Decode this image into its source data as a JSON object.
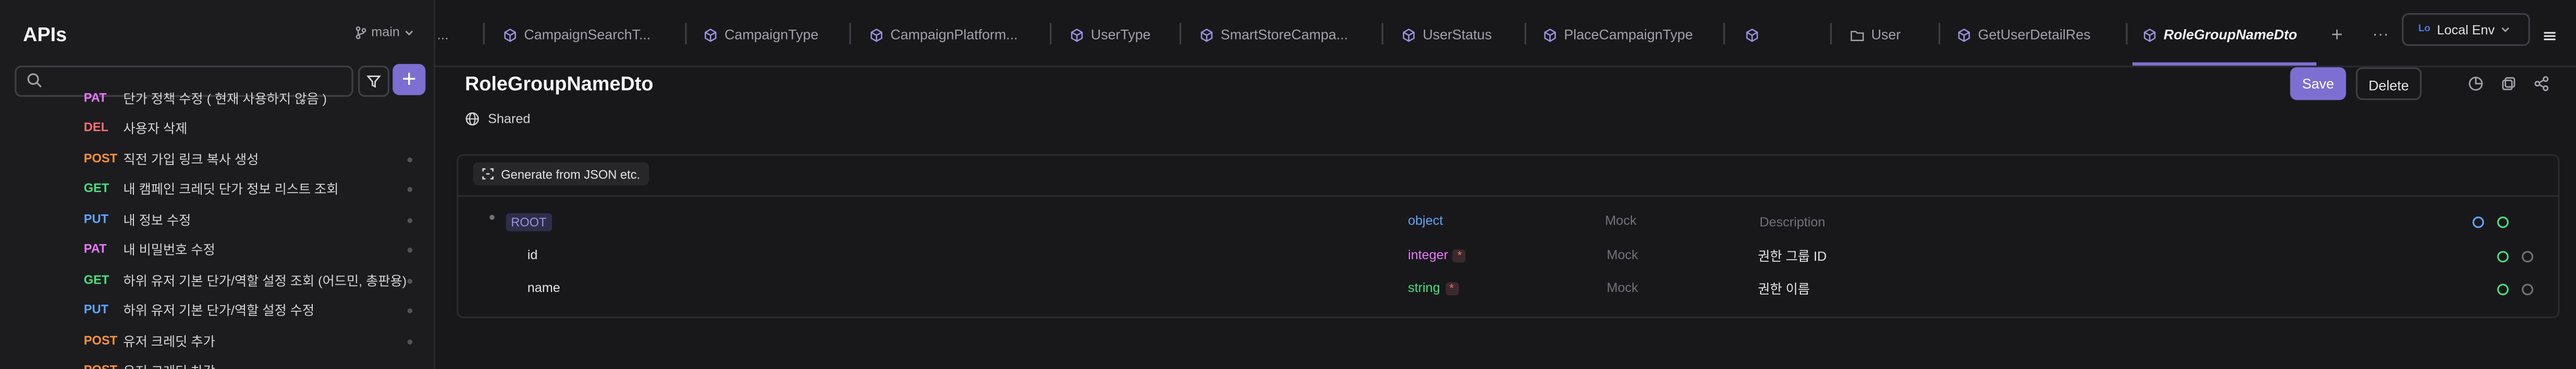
{
  "sidebar": {
    "title": "APIs",
    "branch": "main",
    "search_placeholder": "",
    "add_label": "+",
    "items": [
      {
        "method": "PAT",
        "name": "단가 정책 수정 ( 현재 사용하지 않음 )",
        "color": "#e879f9"
      },
      {
        "method": "DEL",
        "name": "사용자 삭제",
        "color": "#f87171"
      },
      {
        "method": "POST",
        "name": "직전 가입 링크 복사 생성",
        "color": "#fb923c"
      },
      {
        "method": "GET",
        "name": "내 캠페인 크레딧 단가 정보 리스트 조회",
        "color": "#4ade80"
      },
      {
        "method": "PUT",
        "name": "내 정보 수정",
        "color": "#60a5fa"
      },
      {
        "method": "PAT",
        "name": "내 비밀번호 수정",
        "color": "#e879f9"
      },
      {
        "method": "GET",
        "name": "하위 유저 기본 단가/역할 설정 조회 (어드민, 총판용)",
        "color": "#4ade80"
      },
      {
        "method": "PUT",
        "name": "하위 유저 기본 단가/역할 설정 수정",
        "color": "#60a5fa"
      },
      {
        "method": "POST",
        "name": "유저 크레딧 추가",
        "color": "#fb923c"
      },
      {
        "method": "POST",
        "name": "유저 크레딧 차감",
        "color": "#fb923c"
      }
    ]
  },
  "tabs": {
    "overflow": "...",
    "items": [
      {
        "label": "CampaignSearchT...",
        "icon": "cube-icon"
      },
      {
        "label": "CampaignType",
        "icon": "cube-icon"
      },
      {
        "label": "CampaignPlatform...",
        "icon": "cube-icon"
      },
      {
        "label": "UserType",
        "icon": "cube-icon"
      },
      {
        "label": "SmartStoreCampa...",
        "icon": "cube-icon"
      },
      {
        "label": "UserStatus",
        "icon": "cube-icon"
      },
      {
        "label": "PlaceCampaignType",
        "icon": "cube-icon"
      },
      {
        "label": "",
        "icon": "cube-icon"
      },
      {
        "label": "User",
        "icon": "folder-icon"
      },
      {
        "label": "GetUserDetailRes",
        "icon": "cube-icon"
      },
      {
        "label": "RoleGroupNameDto",
        "icon": "cube-icon",
        "active": true
      }
    ],
    "add": "+",
    "more": "···",
    "env_badge": "Lo",
    "env": "Local Env"
  },
  "main": {
    "title": "RoleGroupNameDto",
    "visibility": "Shared",
    "save_label": "Save",
    "delete_label": "Delete",
    "generate_label": "Generate from JSON etc.",
    "schema": {
      "root": {
        "name": "ROOT",
        "type": "object",
        "mock": "Mock",
        "description": "Description"
      },
      "fields": [
        {
          "name": "id",
          "type": "integer",
          "required": "*",
          "mock": "Mock",
          "description": "권한 그룹 ID",
          "type_color": "#e879f9"
        },
        {
          "name": "name",
          "type": "string",
          "required": "*",
          "mock": "Mock",
          "description": "권한 이름",
          "type_color": "#4ade80"
        }
      ]
    }
  }
}
